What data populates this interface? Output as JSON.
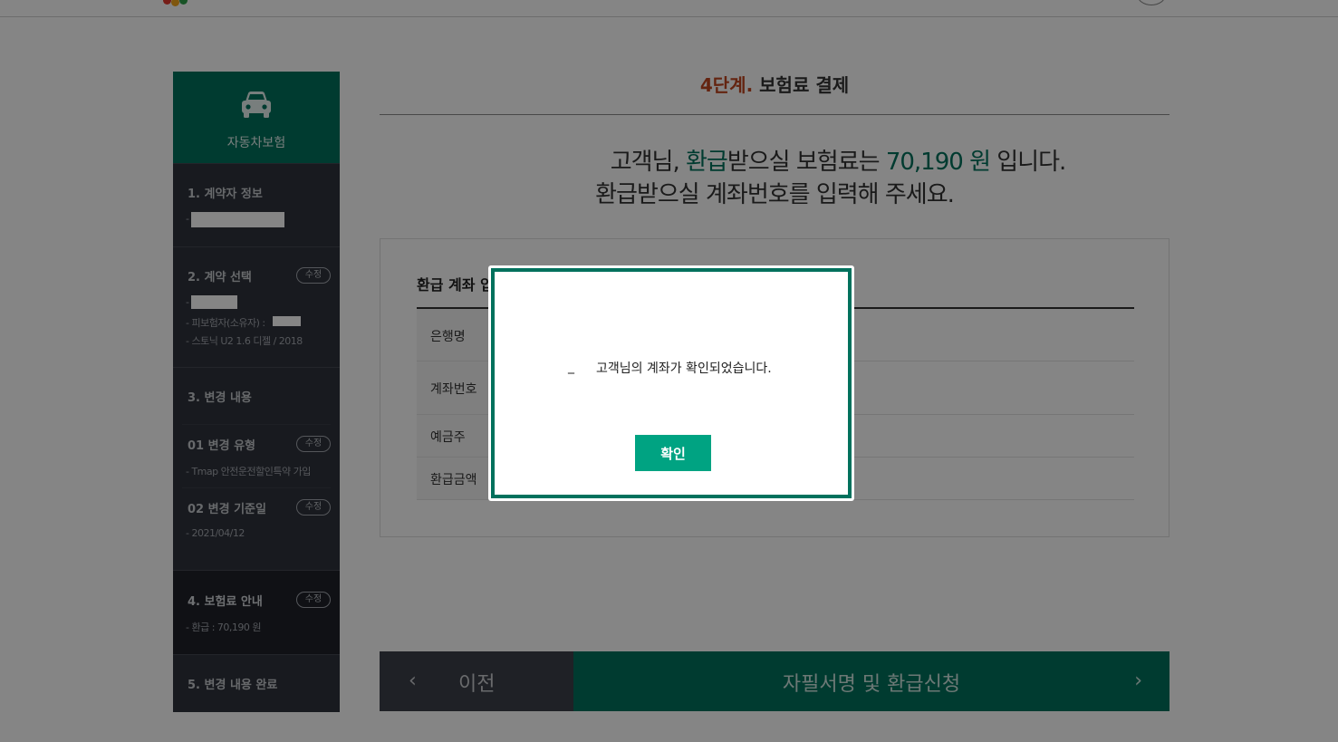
{
  "sidebar": {
    "title": "자동차보험",
    "sections": [
      {
        "title": "1. 계약자 정보",
        "sub": "-"
      },
      {
        "title": "2. 계약 선택",
        "edit": "수정",
        "sub1": "-",
        "sub2": "- 피보험자(소유자) :",
        "sub3": "- 스토닉 U2 1.6 디젤 / 2018"
      },
      {
        "title": "3. 변경 내용"
      },
      {
        "title": "01 변경 유형",
        "edit": "수정",
        "sub": "- Tmap 안전운전할인특약 가입"
      },
      {
        "title": "02 변경 기준일",
        "edit": "수정",
        "sub": "- 2021/04/12"
      },
      {
        "title": "4. 보험료 안내",
        "edit": "수정",
        "sub": "- 환급 : 70,190 원"
      },
      {
        "title": "5. 변경 내용 완료"
      }
    ]
  },
  "main": {
    "step_num": "4단계.",
    "step_title": "보험료 결제",
    "line1_a": "고객님, ",
    "line1_b": "환급",
    "line1_c": "받으실 보험료는 ",
    "line1_d": "70,190 원",
    "line1_e": " 입니다.",
    "line2": "환급받으실 계좌번호를 입력해 주세요.",
    "form_title": "환급 계좌 입",
    "rows": [
      "은행명",
      "계좌번호",
      "예금주",
      "환급금액"
    ],
    "prev_label": "이전",
    "next_label": "자필서명 및 환급신청",
    "prev_chev": "‹",
    "next_chev": "›"
  },
  "modal": {
    "dash": "_",
    "message": "고객님의 계좌가 확인되었습니다.",
    "confirm": "확인"
  },
  "colors": {
    "brand_green": "#00715d",
    "button_green": "#00a382",
    "step_accent": "#c0461f",
    "sidebar_bg": "#2f333c"
  }
}
